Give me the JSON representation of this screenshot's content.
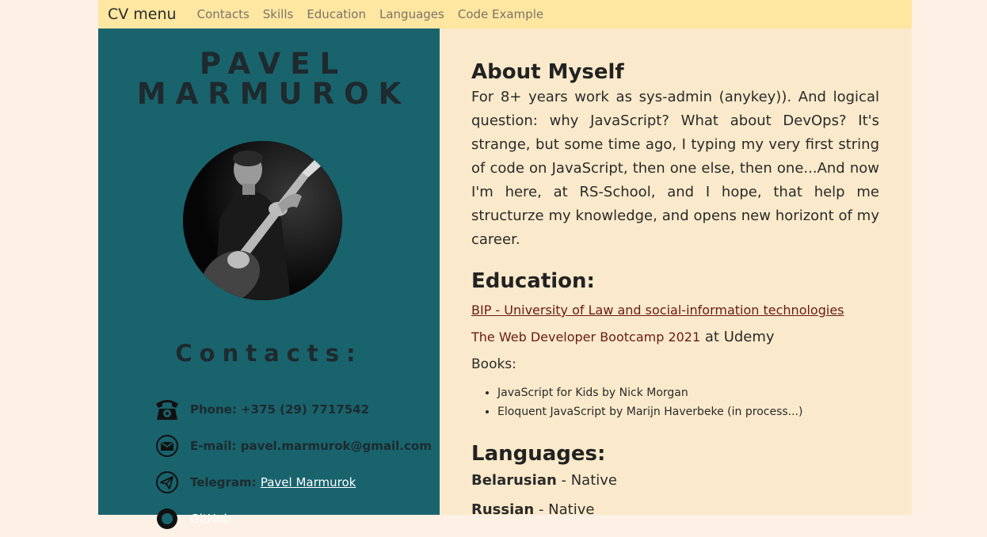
{
  "nav": {
    "brand": "CV menu",
    "links": [
      "Contacts",
      "Skills",
      "Education",
      "Languages",
      "Code Example"
    ]
  },
  "sidebar": {
    "name_first": "PAVEL",
    "name_last": "MARMUROK",
    "contacts_title": "Contacts:",
    "contacts": [
      {
        "icon": "phone-icon",
        "label": "Phone:",
        "value": "+375 (29) 7717542"
      },
      {
        "icon": "mail-icon",
        "label": "E-mail:",
        "value": "pavel.marmurok@gmail.com"
      },
      {
        "icon": "telegram-icon",
        "label": "Telegram:",
        "value": "Pavel Marmurok"
      },
      {
        "icon": "github-icon",
        "label": "",
        "value": "GitHub"
      }
    ]
  },
  "main": {
    "about_title": "About Myself",
    "about_text": "For 8+ years work as sys-admin (anykey)). And logical question: why JavaScript? What about DevOps? It's strange, but some time ago, I typing my very first string of code on JavaScript, then one else, then one...And now I'm here, at RS-School, and I hope, that help me structurze my knowledge, and opens new horizont of my career.",
    "education_title": "Education:",
    "education_link1": "BIP - University of Law and social-information technologies",
    "education_link2": "The Web Developer Bootcamp 2021",
    "education_link2_suffix": " at Udemy",
    "books_label": "Books:",
    "books": [
      "JavaScript for Kids by Nick Morgan",
      "Eloquent JavaScript by Marijn Haverbeke (in process...)"
    ],
    "languages_title": "Languages:",
    "languages": [
      {
        "name": "Belarusian",
        "level": " - Native"
      },
      {
        "name": "Russian",
        "level": " - Native"
      }
    ]
  },
  "colors": {
    "nav_bg": "#ffe7a1",
    "sidebar_bg": "#19636d",
    "main_bg": "#faeacb",
    "page_bg": "#fdf0e5",
    "link": "#6a1a10"
  }
}
